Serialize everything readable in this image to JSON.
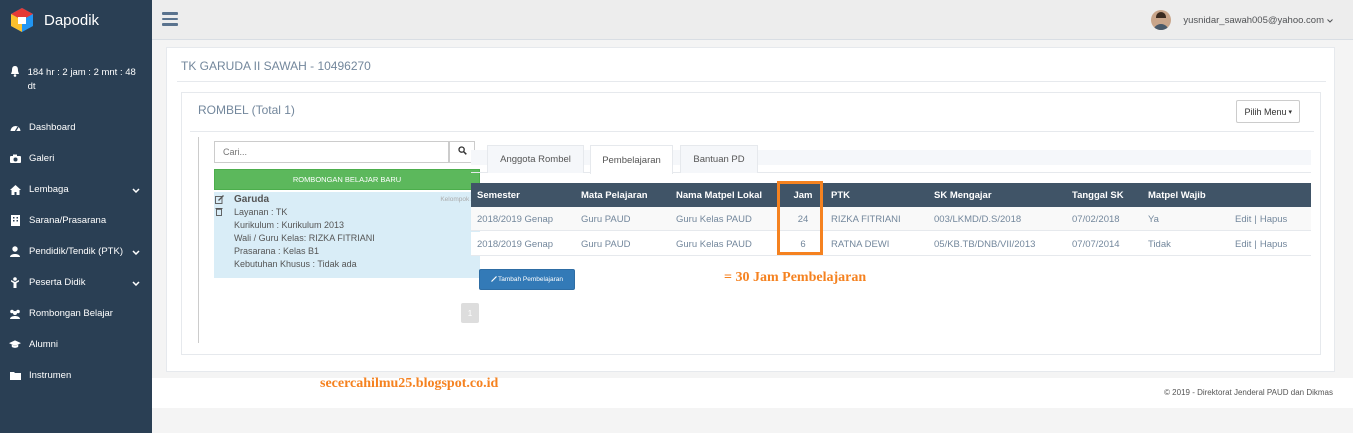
{
  "app": {
    "name": "Dapodik"
  },
  "sidebar": {
    "timer": "184 hr : 2 jam : 2 mnt : 48 dt",
    "items": [
      {
        "label": "Dashboard",
        "icon": "dashboard-icon",
        "has_submenu": false
      },
      {
        "label": "Galeri",
        "icon": "camera-icon",
        "has_submenu": false
      },
      {
        "label": "Lembaga",
        "icon": "home-icon",
        "has_submenu": true
      },
      {
        "label": "Sarana/Prasarana",
        "icon": "building-icon",
        "has_submenu": false
      },
      {
        "label": "Pendidik/Tendik (PTK)",
        "icon": "user-icon",
        "has_submenu": true
      },
      {
        "label": "Peserta Didik",
        "icon": "child-icon",
        "has_submenu": true
      },
      {
        "label": "Rombongan Belajar",
        "icon": "users-icon",
        "has_submenu": false
      },
      {
        "label": "Alumni",
        "icon": "graduation-cap-icon",
        "has_submenu": false
      },
      {
        "label": "Instrumen",
        "icon": "folder-icon",
        "has_submenu": false
      }
    ]
  },
  "topbar": {
    "user_email": "yusnidar_sawah005@yahoo.com"
  },
  "page": {
    "school_title": "TK GARUDA II SAWAH - 10496270",
    "rombel_title": "ROMBEL (Total 1)",
    "pilih_menu": "Pilih Menu",
    "search_placeholder": "Cari...",
    "new_rombel_button": "ROMBONGAN BELAJAR BARU",
    "rombel_card": {
      "name": "Garuda",
      "group": "Kelompok A",
      "lines": [
        "Layanan : TK",
        "Kurikulum : Kurikulum 2013",
        "Wali / Guru Kelas: RIZKA FITRIANI",
        "Prasarana : Kelas B1",
        "Kebutuhan Khusus : Tidak ada"
      ]
    },
    "pagination_current": "1",
    "tabs": [
      "Anggota Rombel",
      "Pembelajaran",
      "Bantuan PD"
    ],
    "active_tab": "Pembelajaran",
    "table": {
      "headers": [
        "Semester",
        "Mata Pelajaran",
        "Nama Matpel Lokal",
        "Jam",
        "PTK",
        "SK Mengajar",
        "Tanggal SK",
        "Matpel Wajib"
      ],
      "rows": [
        [
          "2018/2019 Genap",
          "Guru PAUD",
          "Guru Kelas PAUD",
          "24",
          "RIZKA FITRIANI",
          "003/LKMD/D.S/2018",
          "07/02/2018",
          "Ya"
        ],
        [
          "2018/2019 Genap",
          "Guru PAUD",
          "Guru Kelas PAUD",
          "6",
          "RATNA DEWI",
          "05/KB.TB/DNB/VII/2013",
          "07/07/2014",
          "Tidak"
        ]
      ],
      "edit_label": "Edit",
      "separator": "|",
      "delete_label": "Hapus"
    },
    "add_button": "Tambah Pembelajaran",
    "annotation": "= 30 Jam Pembelajaran",
    "highlight_color": "#f58220"
  },
  "watermark": "secercahilmu25.blogspot.co.id",
  "footer": "©   2019 - Direktorat Jenderal PAUD dan Dikmas"
}
